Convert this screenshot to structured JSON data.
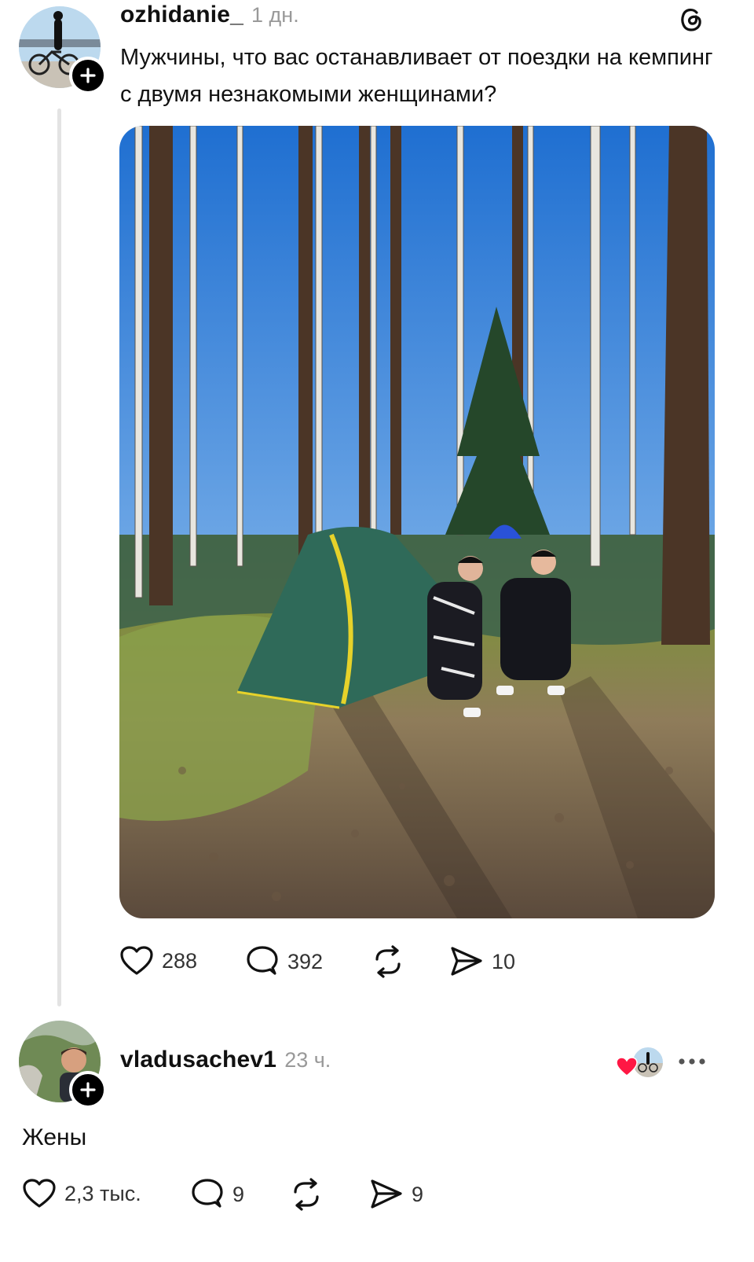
{
  "post": {
    "username": "ozhidanie_",
    "time": "1 дн.",
    "text": "Мужчины, что вас останавливает от поездки на кемпинг с двумя незнакомыми женщинами?",
    "actions": {
      "likes": "288",
      "comments": "392",
      "shares": "10"
    }
  },
  "reply": {
    "username": "vladusachev1",
    "time": "23 ч.",
    "text": "Жены",
    "actions": {
      "likes": "2,3 тыс.",
      "comments": "9",
      "shares": "9"
    }
  },
  "colors": {
    "like_heart": "#ff1744",
    "text": "#111111",
    "muted": "#999999"
  },
  "icons": [
    "threads-logo-icon",
    "plus-icon",
    "heart-icon",
    "comment-icon",
    "repost-icon",
    "share-icon",
    "more-icon"
  ]
}
